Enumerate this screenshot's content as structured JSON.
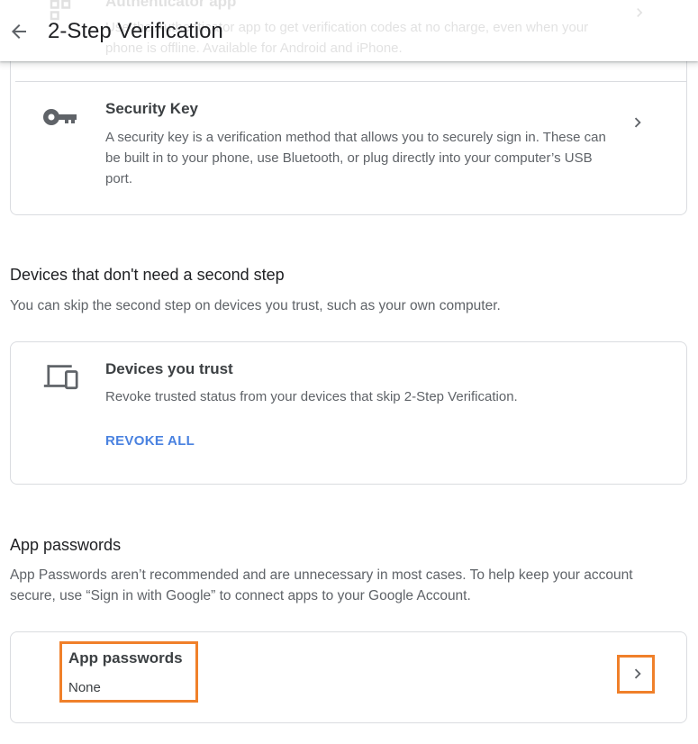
{
  "header": {
    "title": "2-Step Verification"
  },
  "faded_row": {
    "title": "Authenticator app",
    "description": "Use the Authenticator app to get verification codes at no charge, even when your phone is offline. Available for Android and iPhone."
  },
  "security_key": {
    "title": "Security Key",
    "description": "A security key is a verification method that allows you to securely sign in. These can be built in to your phone, use Bluetooth, or plug directly into your computer’s USB port."
  },
  "devices_section": {
    "title": "Devices that don't need a second step",
    "description": "You can skip the second step on devices you trust, such as your own computer."
  },
  "trusted_devices": {
    "title": "Devices you trust",
    "description": "Revoke trusted status from your devices that skip 2-Step Verification.",
    "action_label": "REVOKE ALL"
  },
  "app_passwords_section": {
    "title": "App passwords",
    "description": "App Passwords aren’t recommended and are unnecessary in most cases. To help keep your account secure, use “Sign in with Google” to connect apps to your Google Account."
  },
  "app_passwords_row": {
    "title": "App passwords",
    "value": "None"
  },
  "colors": {
    "accent_link": "#4a82e0",
    "highlight": "#f0802a",
    "divider": "#dadce0"
  },
  "icons": {
    "back": "arrow-back-icon",
    "security_key": "key-icon",
    "trusted_devices": "devices-icon",
    "chevron": "chevron-right-icon"
  }
}
